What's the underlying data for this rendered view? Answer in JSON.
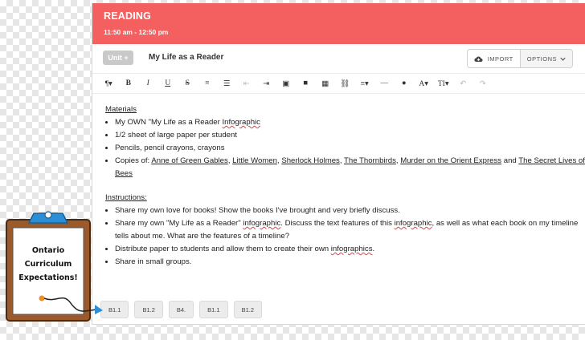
{
  "header": {
    "title": "READING",
    "time": "11:50 am - 12:50 pm"
  },
  "title_row": {
    "unit_label": "Unit +",
    "lesson_title": "My Life as a Reader",
    "import_label": "IMPORT",
    "options_label": "OPTIONS"
  },
  "toolbar": {
    "paragraph": "¶▾",
    "bold": "B",
    "italic": "I",
    "underline": "U",
    "strike": "S",
    "ordered_list": "≡",
    "bullet_list": "☰",
    "outdent": "⇤",
    "indent": "⇥",
    "image": "▣",
    "video": "■",
    "table": "▦",
    "link": "⛓",
    "align": "≡▾",
    "hr": "—",
    "color": "●",
    "font": "A▾",
    "size": "TI▾",
    "undo": "↶",
    "redo": "↷"
  },
  "materials": {
    "heading": "Materials",
    "items": {
      "item1_pre": "My OWN \"My Life as a Reader ",
      "item1_word": "Infographic",
      "item2": "1/2 sheet of large paper per student",
      "item3": "Pencils, pencil crayons, crayons",
      "item4_pre": "Copies of:  ",
      "books": {
        "b1": "Anne of Green Gables",
        "b2": "Little Women",
        "b3": "Sherlock Holmes",
        "b4": "The Thornbirds",
        "b5": "Murder on the Orient Express",
        "b6": "The Secret Lives of Bees"
      },
      "sep": ", ",
      "and": " and "
    }
  },
  "instructions": {
    "heading": "Instructions:",
    "item1": "Share my own love for books!  Show the books I've brought and very briefly discuss.",
    "item2_a": "Share my own \"My Life as a Reader\" ",
    "item2_w1": "infographic",
    "item2_b": ".  Discuss the text features of this ",
    "item2_w2": "infographic",
    "item2_c": ", as well as what each book on my timeline tells about me.  What are the features of a timeline?",
    "item3_a": "Distribute paper to students and allow them to create their own ",
    "item3_w": "infographics",
    "item3_b": ".",
    "item4": "Share in small groups."
  },
  "tags": [
    "B1.1",
    "B1.2",
    "B4.",
    "B1.1",
    "B1.2"
  ],
  "note": {
    "line1": "Ontario",
    "line2": "Curriculum",
    "line3": "Expectations!"
  },
  "colors": {
    "header": "#f45f5f",
    "clipboard": "#9a5a2c",
    "clip": "#2a8fd6",
    "note_bg": "#ffffff"
  }
}
